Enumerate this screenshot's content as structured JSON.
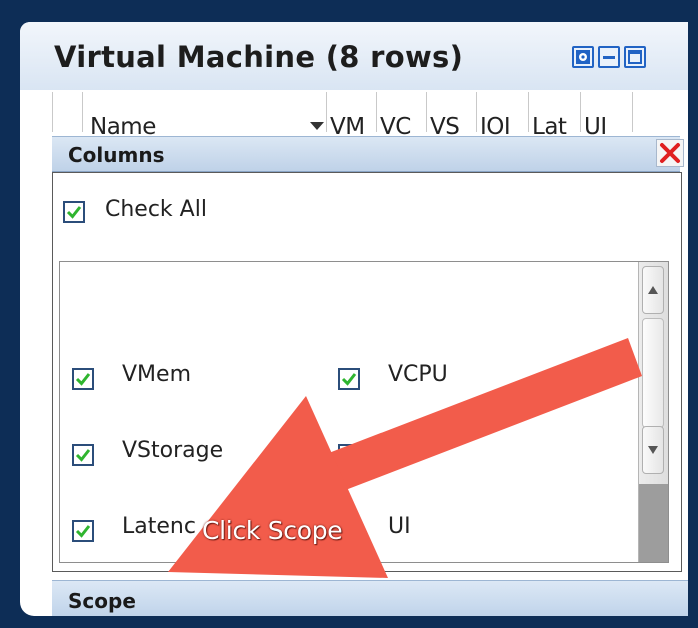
{
  "panel": {
    "title": "Virtual Machine (8 rows)",
    "header_buttons": [
      "settings-icon",
      "minimize-icon",
      "maximize-icon"
    ]
  },
  "table": {
    "columns": [
      "Name",
      "VM",
      "VC",
      "VS",
      "IOI",
      "Lat",
      "UI"
    ]
  },
  "columns_popup": {
    "title": "Columns",
    "check_all_label": "Check All",
    "items": [
      {
        "label": "VMem",
        "checked": true
      },
      {
        "label": "VCPU",
        "checked": true
      },
      {
        "label": "VStorage",
        "checked": true
      },
      {
        "label": "",
        "checked": true
      },
      {
        "label": "Latenc",
        "checked": true
      },
      {
        "label": "UI",
        "checked": true
      }
    ]
  },
  "scope": {
    "label": "Scope"
  },
  "annotation": {
    "text": "Click Scope",
    "color": "#f25c4b"
  },
  "colors": {
    "background": "#0d2d56",
    "header_gradient": "#d9e5f3",
    "accent": "#2163c4",
    "check_green": "#2fb52f",
    "close_red": "#e02020"
  }
}
